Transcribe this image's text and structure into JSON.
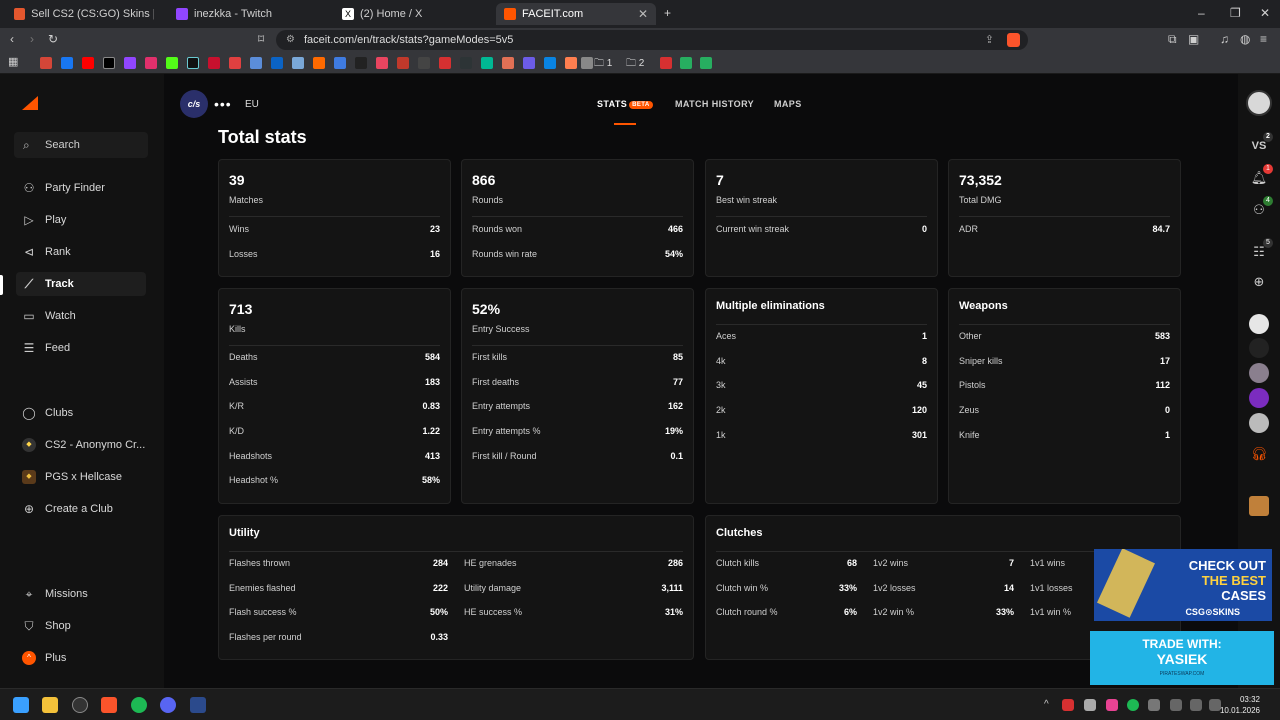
{
  "browser": {
    "tabs": [
      {
        "title": "Sell CS2 (CS:GO) Skins | Best CS2 (CS:",
        "color": "#e4572e"
      },
      {
        "title": "inezkka - Twitch",
        "color": "#9146ff"
      },
      {
        "title": "(2) Home / X",
        "color": "#000000"
      },
      {
        "title": "FACEIT.com",
        "color": "#ff5500"
      }
    ],
    "url": "faceit.com/en/track/stats?gameModes=5v5",
    "bookmark_folders": [
      "1",
      "2"
    ]
  },
  "sidebar": {
    "search_label": "Search",
    "nav": [
      {
        "label": "Party Finder",
        "icon": "party-finder-icon"
      },
      {
        "label": "Play",
        "icon": "play-icon"
      },
      {
        "label": "Rank",
        "icon": "rank-icon"
      },
      {
        "label": "Track",
        "icon": "track-icon"
      },
      {
        "label": "Watch",
        "icon": "watch-icon"
      },
      {
        "label": "Feed",
        "icon": "feed-icon"
      },
      {
        "label": "Clubs",
        "icon": "clubs-icon"
      },
      {
        "label": "CS2 - Anonymo Cr...",
        "icon": "club-avatar"
      },
      {
        "label": "PGS x Hellcase",
        "icon": "club-avatar"
      },
      {
        "label": "Create a Club",
        "icon": "plus-circle-icon"
      },
      {
        "label": "Missions",
        "icon": "missions-icon"
      },
      {
        "label": "Shop",
        "icon": "shop-icon"
      },
      {
        "label": "Plus",
        "icon": "plus-icon"
      }
    ]
  },
  "header": {
    "team_logo_text": "c/s",
    "region": "EU",
    "tabs": [
      "STATS",
      "MATCH HISTORY",
      "MAPS"
    ],
    "beta": "BETA",
    "title": "Total stats"
  },
  "rail": {
    "vs_label": "VS",
    "vs_badge": "2",
    "notif_badge": "1",
    "friends_badge": "4",
    "party_badge": "5"
  },
  "cards": {
    "matches": {
      "big": "39",
      "sub": "Matches",
      "rows": [
        {
          "l": "Wins",
          "v": "23"
        },
        {
          "l": "Losses",
          "v": "16"
        }
      ]
    },
    "rounds": {
      "big": "866",
      "sub": "Rounds",
      "rows": [
        {
          "l": "Rounds won",
          "v": "466"
        },
        {
          "l": "Rounds win rate",
          "v": "54%"
        }
      ]
    },
    "streak": {
      "big": "7",
      "sub": "Best win streak",
      "rows": [
        {
          "l": "Current win streak",
          "v": "0"
        }
      ]
    },
    "dmg": {
      "big": "73,352",
      "sub": "Total DMG",
      "rows": [
        {
          "l": "ADR",
          "v": "84.7"
        }
      ]
    },
    "kills": {
      "big": "713",
      "sub": "Kills",
      "rows": [
        {
          "l": "Deaths",
          "v": "584"
        },
        {
          "l": "Assists",
          "v": "183"
        },
        {
          "l": "K/R",
          "v": "0.83"
        },
        {
          "l": "K/D",
          "v": "1.22"
        },
        {
          "l": "Headshots",
          "v": "413"
        },
        {
          "l": "Headshot %",
          "v": "58%"
        }
      ]
    },
    "entry": {
      "big": "52%",
      "sub": "Entry Success",
      "rows": [
        {
          "l": "First kills",
          "v": "85"
        },
        {
          "l": "First deaths",
          "v": "77"
        },
        {
          "l": "Entry attempts",
          "v": "162"
        },
        {
          "l": "Entry attempts %",
          "v": "19%"
        },
        {
          "l": "First kill / Round",
          "v": "0.1"
        }
      ]
    },
    "multi": {
      "head": "Multiple eliminations",
      "rows": [
        {
          "l": "Aces",
          "v": "1"
        },
        {
          "l": "4k",
          "v": "8"
        },
        {
          "l": "3k",
          "v": "45"
        },
        {
          "l": "2k",
          "v": "120"
        },
        {
          "l": "1k",
          "v": "301"
        }
      ]
    },
    "weapons": {
      "head": "Weapons",
      "rows": [
        {
          "l": "Other",
          "v": "583"
        },
        {
          "l": "Sniper kills",
          "v": "17"
        },
        {
          "l": "Pistols",
          "v": "112"
        },
        {
          "l": "Zeus",
          "v": "0"
        },
        {
          "l": "Knife",
          "v": "1"
        }
      ]
    },
    "utility": {
      "head": "Utility",
      "left": [
        {
          "l": "Flashes thrown",
          "v": "284"
        },
        {
          "l": "Enemies flashed",
          "v": "222"
        },
        {
          "l": "Flash success %",
          "v": "50%"
        },
        {
          "l": "Flashes per round",
          "v": "0.33"
        }
      ],
      "right": [
        {
          "l": "HE grenades",
          "v": "286"
        },
        {
          "l": "Utility damage",
          "v": "3,111"
        },
        {
          "l": "HE success %",
          "v": "31%"
        }
      ]
    },
    "clutches": {
      "head": "Clutches",
      "c1": [
        {
          "l": "Clutch kills",
          "v": "68"
        },
        {
          "l": "Clutch win %",
          "v": "33%"
        },
        {
          "l": "Clutch round %",
          "v": "6%"
        }
      ],
      "c2": [
        {
          "l": "1v2 wins",
          "v": "7"
        },
        {
          "l": "1v2 losses",
          "v": "14"
        },
        {
          "l": "1v2 win %",
          "v": "33%"
        }
      ],
      "c3": [
        {
          "l": "1v1 wins"
        },
        {
          "l": "1v1 losses"
        },
        {
          "l": "1v1 win %"
        }
      ]
    }
  },
  "ads": {
    "ad1_lines": [
      "CHECK OUT",
      "THE BEST",
      "CASES"
    ],
    "ad1_brand": "CSG⊙SKINS",
    "ad2_line1": "TRADE WITH:",
    "ad2_line2": "YASIEK",
    "ad2_footer": "PIRATESWAP.COM"
  },
  "taskbar": {
    "time": "03:32",
    "date": "10.01.2026"
  }
}
